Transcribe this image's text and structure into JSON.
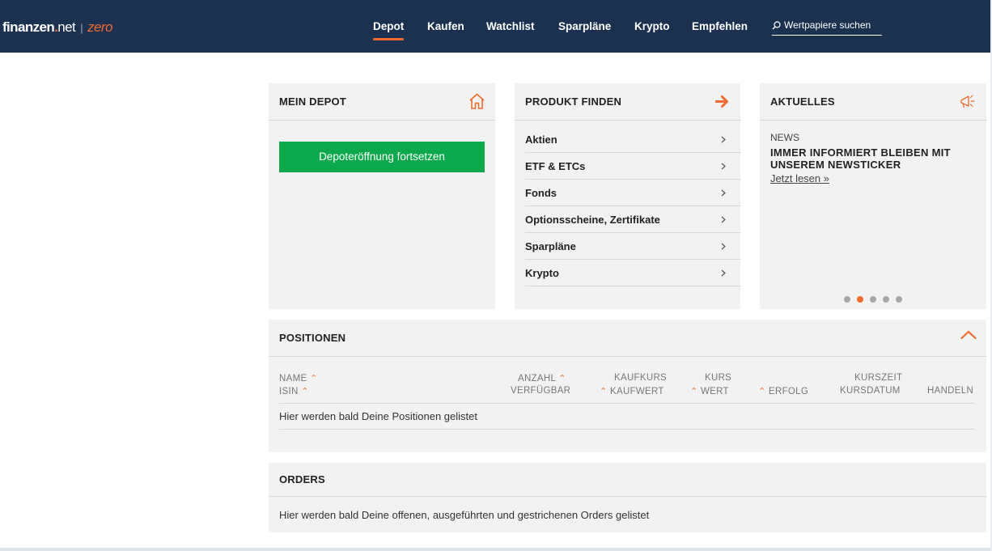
{
  "header": {
    "logo": {
      "brand": "finanzen",
      "dot": ".",
      "tld": "net",
      "separator": "|",
      "product": "zero"
    },
    "nav": [
      {
        "label": "Depot",
        "active": true
      },
      {
        "label": "Kaufen",
        "active": false
      },
      {
        "label": "Watchlist",
        "active": false
      },
      {
        "label": "Sparpläne",
        "active": false
      },
      {
        "label": "Krypto",
        "active": false
      },
      {
        "label": "Empfehlen",
        "active": false
      }
    ],
    "search": {
      "icon": "search-icon",
      "placeholder": "Wertpapiere suchen"
    }
  },
  "mein_depot": {
    "title": "MEIN DEPOT",
    "icon": "home-icon",
    "button_label": "Depoteröffnung fortsetzen"
  },
  "produkt_finden": {
    "title": "PRODUKT FINDEN",
    "icon": "arrow-right-icon",
    "items": [
      {
        "label": "Aktien"
      },
      {
        "label": "ETF & ETCs"
      },
      {
        "label": "Fonds"
      },
      {
        "label": "Optionsscheine, Zertifikate"
      },
      {
        "label": "Sparpläne"
      },
      {
        "label": "Krypto"
      }
    ]
  },
  "aktuelles": {
    "title": "AKTUELLES",
    "icon": "megaphone-icon",
    "tag": "NEWS",
    "headline": "IMMER INFORMIERT BLEIBEN MIT UNSEREM NEWSTICKER",
    "link": "Jetzt lesen »",
    "slides": 5,
    "active_slide": 2
  },
  "positionen": {
    "title": "POSITIONEN",
    "icon": "chevron-up-icon",
    "columns": {
      "name": "NAME",
      "isin": "ISIN",
      "anzahl": "ANZAHL",
      "verfuegbar": "VERFÜGBAR",
      "kaufkurs": "KAUFKURS",
      "kaufwert": "KAUFWERT",
      "kurs": "KURS",
      "wert": "WERT",
      "erfolg": "ERFOLG",
      "kurszeit": "KURSZEIT",
      "kursdatum": "KURSDATUM",
      "handeln": "HANDELN"
    },
    "empty_message": "Hier werden bald Deine Positionen gelistet"
  },
  "orders": {
    "title": "ORDERS",
    "empty_message": "Hier werden bald Deine offenen, ausgeführten und gestrichenen Orders gelistet"
  },
  "colors": {
    "header_bg": "#1c3150",
    "accent": "#ef6b2f",
    "button_green": "#0ba94b",
    "card_bg": "#f2f2f2"
  }
}
